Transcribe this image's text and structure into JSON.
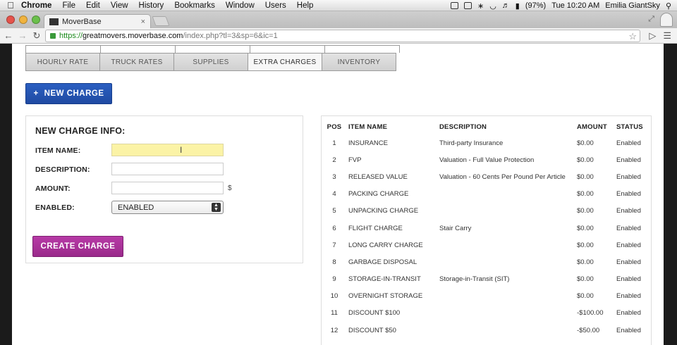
{
  "menubar": {
    "app": "Chrome",
    "items": [
      "File",
      "Edit",
      "View",
      "History",
      "Bookmarks",
      "Window",
      "Users",
      "Help"
    ],
    "battery": "(97%)",
    "clock": "Tue 10:20 AM",
    "user": "Emilia GiantSky"
  },
  "browser": {
    "tab_title": "MoverBase",
    "url_scheme": "https://",
    "url_host": "greatmovers.moverbase.com",
    "url_path": "/index.php?tl=3&sp=6&ic=1"
  },
  "tabs": [
    {
      "label": "HOURLY RATE",
      "active": false
    },
    {
      "label": "TRUCK RATES",
      "active": false
    },
    {
      "label": "SUPPLIES",
      "active": false
    },
    {
      "label": "EXTRA CHARGES",
      "active": true
    },
    {
      "label": "INVENTORY",
      "active": false
    }
  ],
  "new_charge_button": "NEW CHARGE",
  "form": {
    "title": "NEW CHARGE INFO:",
    "item_name_label": "ITEM NAME:",
    "item_name_value": "",
    "description_label": "DESCRIPTION:",
    "description_value": "",
    "amount_label": "AMOUNT:",
    "amount_value": "",
    "currency": "$",
    "enabled_label": "ENABLED:",
    "enabled_value": "ENABLED",
    "create_button": "CREATE CHARGE"
  },
  "table": {
    "headers": {
      "pos": "POS",
      "name": "ITEM NAME",
      "desc": "DESCRIPTION",
      "amount": "AMOUNT",
      "status": "STATUS"
    },
    "rows": [
      {
        "pos": "1",
        "name": "INSURANCE",
        "desc": "Third-party Insurance",
        "amount": "$0.00",
        "status": "Enabled"
      },
      {
        "pos": "2",
        "name": "FVP",
        "desc": "Valuation - Full Value Protection",
        "amount": "$0.00",
        "status": "Enabled"
      },
      {
        "pos": "3",
        "name": "RELEASED VALUE",
        "desc": "Valuation - 60 Cents Per Pound Per Article",
        "amount": "$0.00",
        "status": "Enabled"
      },
      {
        "pos": "4",
        "name": "PACKING CHARGE",
        "desc": "",
        "amount": "$0.00",
        "status": "Enabled"
      },
      {
        "pos": "5",
        "name": "UNPACKING CHARGE",
        "desc": "",
        "amount": "$0.00",
        "status": "Enabled"
      },
      {
        "pos": "6",
        "name": "FLIGHT CHARGE",
        "desc": "Stair Carry",
        "amount": "$0.00",
        "status": "Enabled"
      },
      {
        "pos": "7",
        "name": "LONG CARRY CHARGE",
        "desc": "",
        "amount": "$0.00",
        "status": "Enabled"
      },
      {
        "pos": "8",
        "name": "GARBAGE DISPOSAL",
        "desc": "",
        "amount": "$0.00",
        "status": "Enabled"
      },
      {
        "pos": "9",
        "name": "STORAGE-IN-TRANSIT",
        "desc": "Storage-in-Transit (SIT)",
        "amount": "$0.00",
        "status": "Enabled"
      },
      {
        "pos": "10",
        "name": "OVERNIGHT STORAGE",
        "desc": "",
        "amount": "$0.00",
        "status": "Enabled"
      },
      {
        "pos": "11",
        "name": "DISCOUNT $100",
        "desc": "",
        "amount": "-$100.00",
        "status": "Enabled"
      },
      {
        "pos": "12",
        "name": "DISCOUNT $50",
        "desc": "",
        "amount": "-$50.00",
        "status": "Enabled"
      }
    ]
  }
}
